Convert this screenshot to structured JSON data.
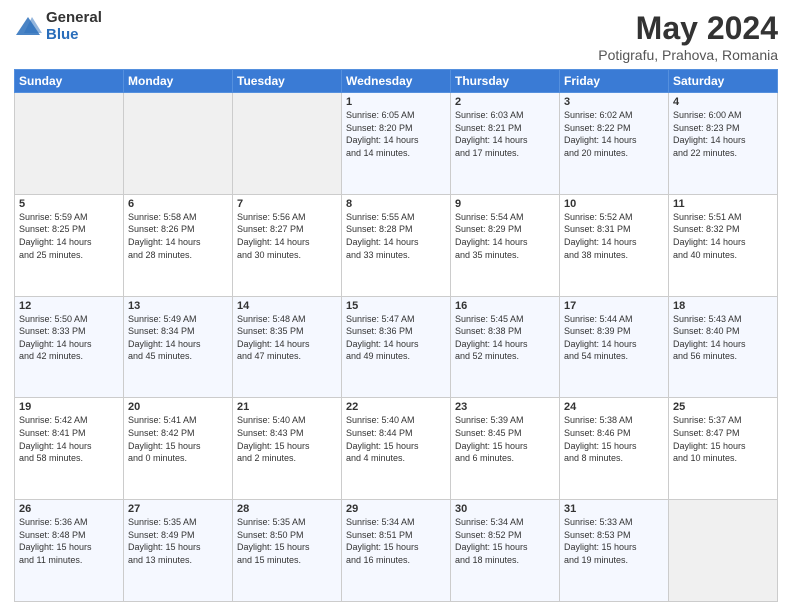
{
  "header": {
    "logo_general": "General",
    "logo_blue": "Blue",
    "title": "May 2024",
    "location": "Potigrafu, Prahova, Romania"
  },
  "weekdays": [
    "Sunday",
    "Monday",
    "Tuesday",
    "Wednesday",
    "Thursday",
    "Friday",
    "Saturday"
  ],
  "weeks": [
    [
      {
        "day": "",
        "info": ""
      },
      {
        "day": "",
        "info": ""
      },
      {
        "day": "",
        "info": ""
      },
      {
        "day": "1",
        "info": "Sunrise: 6:05 AM\nSunset: 8:20 PM\nDaylight: 14 hours\nand 14 minutes."
      },
      {
        "day": "2",
        "info": "Sunrise: 6:03 AM\nSunset: 8:21 PM\nDaylight: 14 hours\nand 17 minutes."
      },
      {
        "day": "3",
        "info": "Sunrise: 6:02 AM\nSunset: 8:22 PM\nDaylight: 14 hours\nand 20 minutes."
      },
      {
        "day": "4",
        "info": "Sunrise: 6:00 AM\nSunset: 8:23 PM\nDaylight: 14 hours\nand 22 minutes."
      }
    ],
    [
      {
        "day": "5",
        "info": "Sunrise: 5:59 AM\nSunset: 8:25 PM\nDaylight: 14 hours\nand 25 minutes."
      },
      {
        "day": "6",
        "info": "Sunrise: 5:58 AM\nSunset: 8:26 PM\nDaylight: 14 hours\nand 28 minutes."
      },
      {
        "day": "7",
        "info": "Sunrise: 5:56 AM\nSunset: 8:27 PM\nDaylight: 14 hours\nand 30 minutes."
      },
      {
        "day": "8",
        "info": "Sunrise: 5:55 AM\nSunset: 8:28 PM\nDaylight: 14 hours\nand 33 minutes."
      },
      {
        "day": "9",
        "info": "Sunrise: 5:54 AM\nSunset: 8:29 PM\nDaylight: 14 hours\nand 35 minutes."
      },
      {
        "day": "10",
        "info": "Sunrise: 5:52 AM\nSunset: 8:31 PM\nDaylight: 14 hours\nand 38 minutes."
      },
      {
        "day": "11",
        "info": "Sunrise: 5:51 AM\nSunset: 8:32 PM\nDaylight: 14 hours\nand 40 minutes."
      }
    ],
    [
      {
        "day": "12",
        "info": "Sunrise: 5:50 AM\nSunset: 8:33 PM\nDaylight: 14 hours\nand 42 minutes."
      },
      {
        "day": "13",
        "info": "Sunrise: 5:49 AM\nSunset: 8:34 PM\nDaylight: 14 hours\nand 45 minutes."
      },
      {
        "day": "14",
        "info": "Sunrise: 5:48 AM\nSunset: 8:35 PM\nDaylight: 14 hours\nand 47 minutes."
      },
      {
        "day": "15",
        "info": "Sunrise: 5:47 AM\nSunset: 8:36 PM\nDaylight: 14 hours\nand 49 minutes."
      },
      {
        "day": "16",
        "info": "Sunrise: 5:45 AM\nSunset: 8:38 PM\nDaylight: 14 hours\nand 52 minutes."
      },
      {
        "day": "17",
        "info": "Sunrise: 5:44 AM\nSunset: 8:39 PM\nDaylight: 14 hours\nand 54 minutes."
      },
      {
        "day": "18",
        "info": "Sunrise: 5:43 AM\nSunset: 8:40 PM\nDaylight: 14 hours\nand 56 minutes."
      }
    ],
    [
      {
        "day": "19",
        "info": "Sunrise: 5:42 AM\nSunset: 8:41 PM\nDaylight: 14 hours\nand 58 minutes."
      },
      {
        "day": "20",
        "info": "Sunrise: 5:41 AM\nSunset: 8:42 PM\nDaylight: 15 hours\nand 0 minutes."
      },
      {
        "day": "21",
        "info": "Sunrise: 5:40 AM\nSunset: 8:43 PM\nDaylight: 15 hours\nand 2 minutes."
      },
      {
        "day": "22",
        "info": "Sunrise: 5:40 AM\nSunset: 8:44 PM\nDaylight: 15 hours\nand 4 minutes."
      },
      {
        "day": "23",
        "info": "Sunrise: 5:39 AM\nSunset: 8:45 PM\nDaylight: 15 hours\nand 6 minutes."
      },
      {
        "day": "24",
        "info": "Sunrise: 5:38 AM\nSunset: 8:46 PM\nDaylight: 15 hours\nand 8 minutes."
      },
      {
        "day": "25",
        "info": "Sunrise: 5:37 AM\nSunset: 8:47 PM\nDaylight: 15 hours\nand 10 minutes."
      }
    ],
    [
      {
        "day": "26",
        "info": "Sunrise: 5:36 AM\nSunset: 8:48 PM\nDaylight: 15 hours\nand 11 minutes."
      },
      {
        "day": "27",
        "info": "Sunrise: 5:35 AM\nSunset: 8:49 PM\nDaylight: 15 hours\nand 13 minutes."
      },
      {
        "day": "28",
        "info": "Sunrise: 5:35 AM\nSunset: 8:50 PM\nDaylight: 15 hours\nand 15 minutes."
      },
      {
        "day": "29",
        "info": "Sunrise: 5:34 AM\nSunset: 8:51 PM\nDaylight: 15 hours\nand 16 minutes."
      },
      {
        "day": "30",
        "info": "Sunrise: 5:34 AM\nSunset: 8:52 PM\nDaylight: 15 hours\nand 18 minutes."
      },
      {
        "day": "31",
        "info": "Sunrise: 5:33 AM\nSunset: 8:53 PM\nDaylight: 15 hours\nand 19 minutes."
      },
      {
        "day": "",
        "info": ""
      }
    ]
  ]
}
